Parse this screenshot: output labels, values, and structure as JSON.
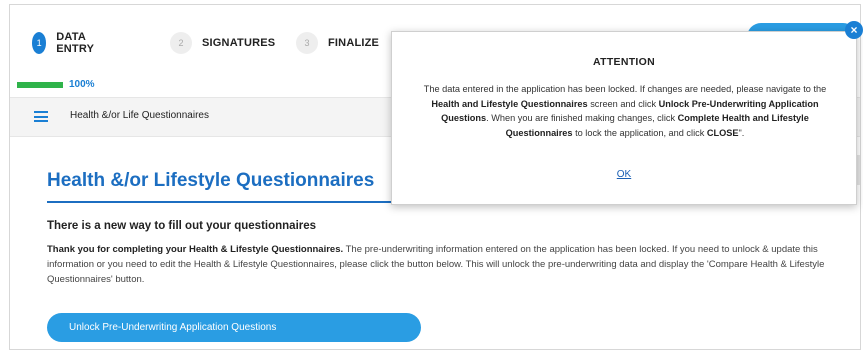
{
  "stepper": {
    "steps": [
      {
        "num": "1",
        "label": "DATA ENTRY"
      },
      {
        "num": "2",
        "label": "SIGNATURES"
      },
      {
        "num": "3",
        "label": "FINALIZE"
      }
    ]
  },
  "progress": {
    "value": 100,
    "label": "100%",
    "color": "#2fb34a"
  },
  "breadcrumb": {
    "text": "Health &/or Life Questionnaires"
  },
  "main": {
    "title": "Health &/or Lifestyle Questionnaires",
    "heading": "There is a new way to fill out your questionnaires",
    "paragraph_bold": "Thank you for completing your Health & Lifestyle Questionnaires.",
    "paragraph_rest": " The pre-underwriting information entered on the application has been locked. If you need to unlock & update this information or you need to edit the Health & Lifestyle Questionnaires, please click the button below. This will unlock the pre-underwriting data and display the 'Compare Health & Lifestyle Questionnaires' button.",
    "unlock_button": "Unlock Pre-Underwriting Application Questions"
  },
  "modal": {
    "title": "ATTENTION",
    "body_1": "The data entered in the application has been locked. If changes are needed, please navigate to the ",
    "body_bold_1": "Health and Lifestyle Questionnaires",
    "body_2": " screen and click ",
    "body_bold_2": "Unlock Pre-Underwriting Application Questions",
    "body_3": ". When you are finished making changes, click ",
    "body_bold_3": "Complete Health and Lifestyle Questionnaires",
    "body_4": " to lock the application, and click ",
    "body_bold_4": "CLOSE",
    "body_5": "\".",
    "ok": "OK",
    "close_glyph": "×"
  },
  "colors": {
    "accent": "#1a7fd4",
    "button": "#2a9de3",
    "title": "#1c6ec1"
  },
  "icons": {
    "menu": "hamburger-icon",
    "close": "close-icon"
  }
}
